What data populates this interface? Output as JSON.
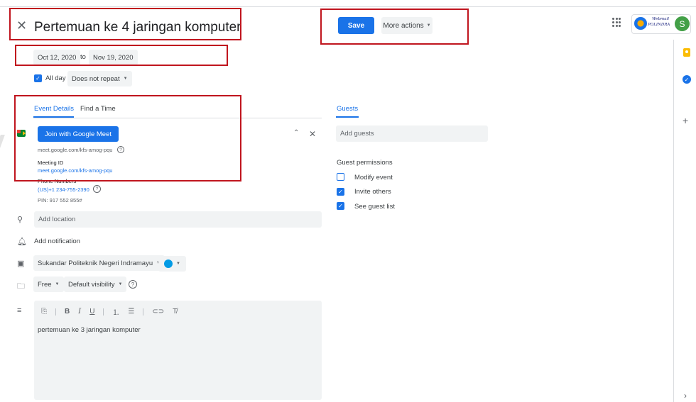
{
  "header": {
    "close_icon": "close-icon",
    "title": "Pertemuan ke 4 jaringan komputer",
    "save_label": "Save",
    "more_actions_label": "More actions",
    "avatar_letter": "S",
    "logo_line1": "Webmail",
    "logo_line2": "POLINDRA"
  },
  "date": {
    "start": "Oct 12, 2020",
    "to_label": "to",
    "end": "Nov 19, 2020",
    "all_day_label": "All day",
    "all_day_checked": true,
    "repeat_label": "Does not repeat"
  },
  "tabs": [
    {
      "label": "Event Details",
      "active": true
    },
    {
      "label": "Find a Time",
      "active": false
    }
  ],
  "meet": {
    "button_label": "Join with Google Meet",
    "link": "meet.google.com/kfs-amog-pqu",
    "meeting_id_label": "Meeting ID",
    "meeting_id_link": "meet.google.com/kfs-amog-pqu",
    "phone_label": "Phone Numbers",
    "phone": "(US)+1 234-755-2390",
    "pin": "PIN: 917 552 855#"
  },
  "fields": {
    "location_placeholder": "Add location",
    "notification_label": "Add notification",
    "calendar_name": "Sukandar Politeknik Negeri Indramayu",
    "event_color": "#039be5",
    "availability": "Free",
    "visibility": "Default visibility"
  },
  "description": {
    "toolbar": [
      "B",
      "I",
      "U"
    ],
    "text": "pertemuan ke 3 jaringan komputer"
  },
  "guests": {
    "tab_label": "Guests",
    "add_placeholder": "Add guests",
    "permissions_title": "Guest permissions",
    "permissions": [
      {
        "label": "Modify event",
        "checked": false
      },
      {
        "label": "Invite others",
        "checked": true
      },
      {
        "label": "See guest list",
        "checked": true
      }
    ]
  },
  "colors": {
    "accent": "#1a73e8",
    "highlight": "#c0151e"
  }
}
